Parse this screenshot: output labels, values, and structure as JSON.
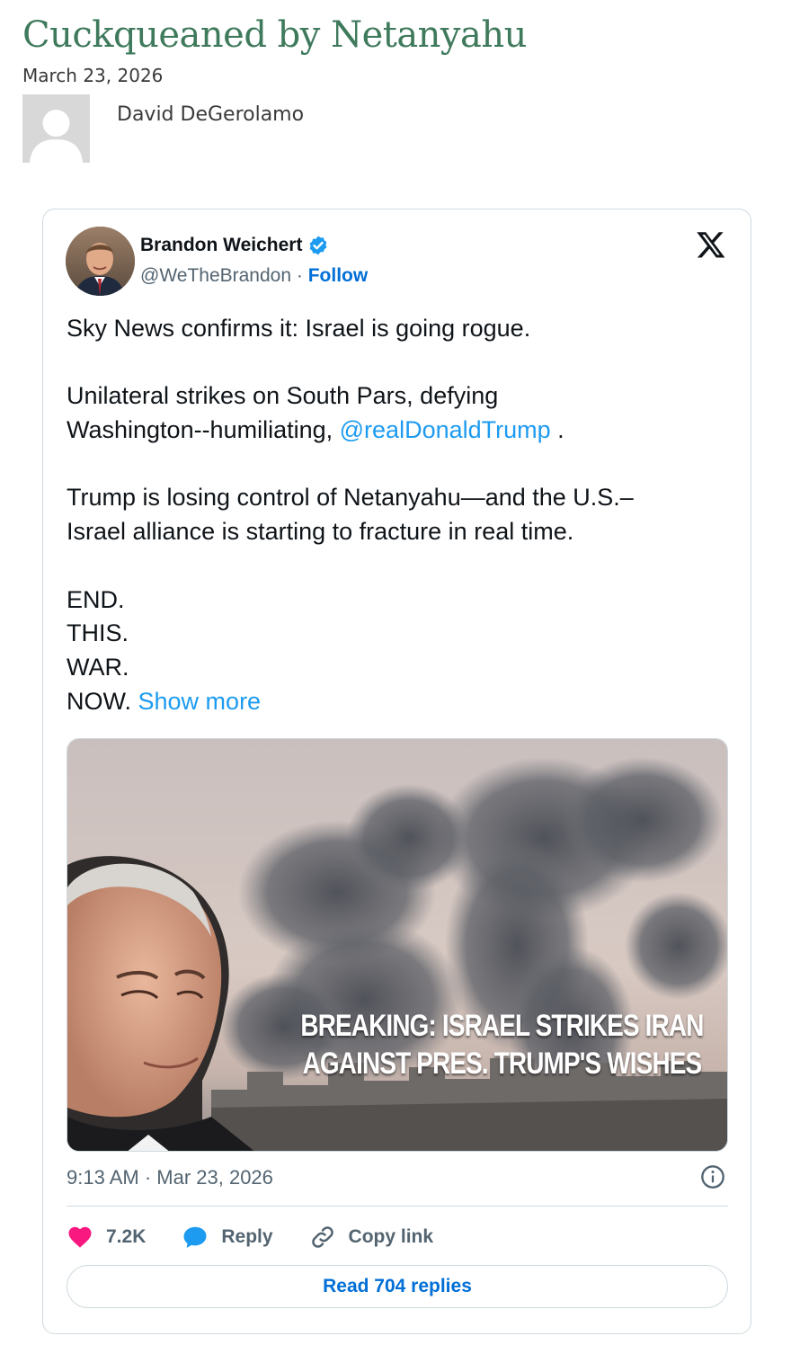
{
  "post": {
    "title": "Cuckqueaned by Netanyahu",
    "date": "March 23, 2026",
    "author": "David DeGerolamo"
  },
  "tweet": {
    "name": "Brandon Weichert",
    "handle": "@WeTheBrandon",
    "separator": " · ",
    "follow_label": "Follow",
    "text": {
      "p1": "Sky News confirms it: Israel is going rogue.",
      "p2_line1": "Unilateral strikes on South Pars, defying",
      "p2_line2": "Washington--humiliating, ",
      "p2_mention": "@realDonaldTrump",
      "p2_end": " .",
      "p3_line1": "Trump is losing control of Netanyahu—and the U.S.–",
      "p3_line2": "Israel alliance is starting to fracture in real time.",
      "p4_line1": "END.",
      "p4_line2": "THIS.",
      "p4_line3": "WAR.",
      "p4_line4": "NOW.",
      "show_more": "Show more"
    },
    "media": {
      "caption_line1": "BREAKING: ISRAEL STRIKES IRAN",
      "caption_line2": "AGAINST PRES. TRUMP'S WISHES"
    },
    "timestamp": "9:13 AM · Mar 23, 2026",
    "actions": {
      "likes": "7.2K",
      "reply_label": "Reply",
      "copy_link_label": "Copy link"
    },
    "read_replies_label": "Read 704 replies"
  },
  "colors": {
    "title_green": "#3f7a5c",
    "link_blue": "#1d9bf0",
    "button_blue": "#006fd6",
    "like_pink": "#f91880"
  },
  "icons": [
    "verified-badge-icon",
    "x-logo-icon",
    "info-icon",
    "heart-icon",
    "reply-bubble-icon",
    "link-icon",
    "avatar-placeholder-icon"
  ]
}
